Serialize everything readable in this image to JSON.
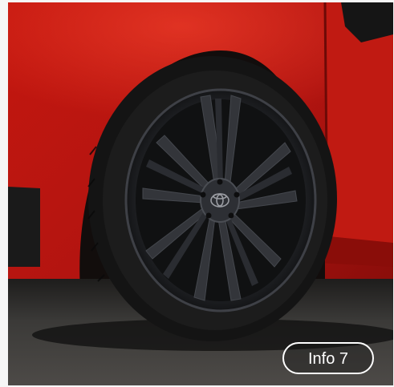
{
  "gallery": {
    "info_button_label": "Info 7"
  },
  "colors": {
    "car_body": "#b8130f",
    "wheel": "#2a2c30",
    "tire": "#151515",
    "road": "#3a3836",
    "button_border": "#ffffff"
  },
  "icons": {
    "wheel_emblem": "toyota-logo-icon"
  }
}
